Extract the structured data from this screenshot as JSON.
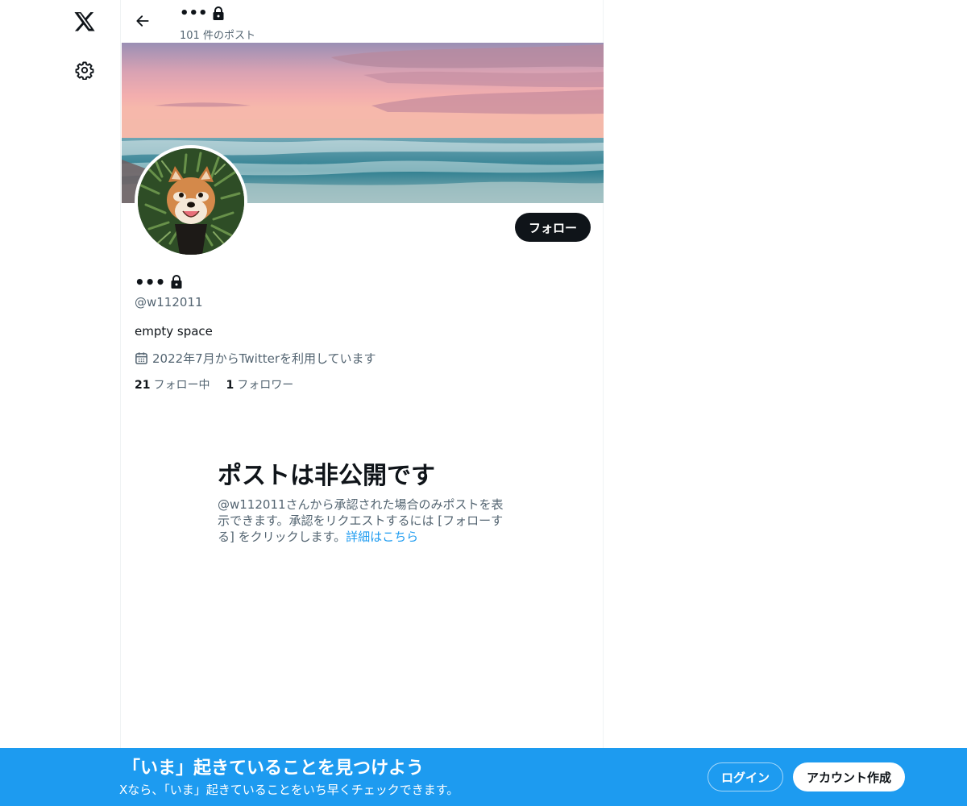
{
  "nav": {
    "logo_icon": "x-logo-icon",
    "settings_icon": "gear-icon"
  },
  "header": {
    "title": "•••",
    "lock_icon": "lock-icon",
    "post_count": "101 件のポスト",
    "back_icon": "arrow-left-icon"
  },
  "profile": {
    "name": "•••",
    "handle": "@w112011",
    "bio": "empty space",
    "joined": "2022年7月からTwitterを利用しています",
    "calendar_icon": "calendar-icon",
    "following_count": "21",
    "following_label": "フォロー中",
    "followers_count": "1",
    "followers_label": "フォロワー",
    "follow_button": "フォロー"
  },
  "private_notice": {
    "title": "ポストは非公開です",
    "description": "@w112011さんから承認された場合のみポストを表示できます。承認をリクエストするには [フォローする] をクリックします。",
    "link": "詳細はこちら"
  },
  "bottom_bar": {
    "title": "「いま」起きていることを見つけよう",
    "subtitle": "Xなら、「いま」起きていることをいち早くチェックできます。",
    "login_button": "ログイン",
    "signup_button": "アカウント作成"
  },
  "colors": {
    "accent": "#1d9bf0",
    "text": "#0f1419",
    "secondary_text": "#536471"
  }
}
